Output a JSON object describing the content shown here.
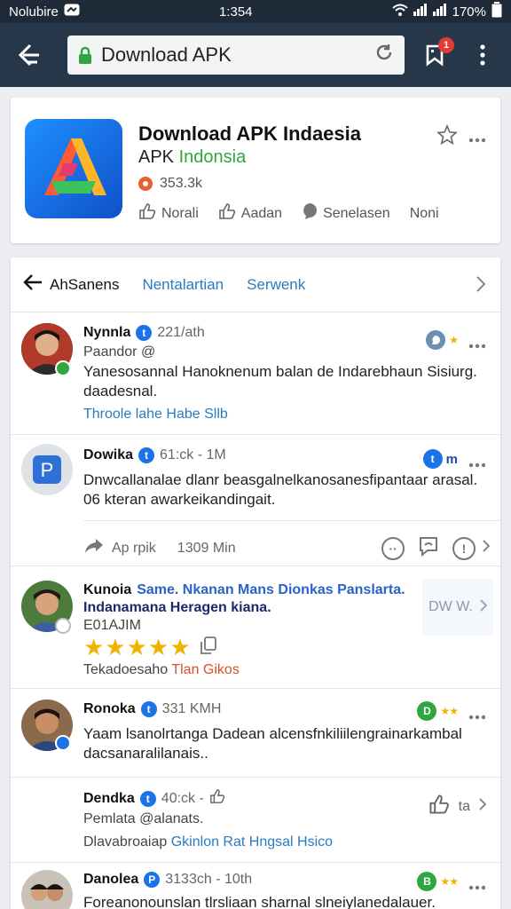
{
  "status_bar": {
    "carrier": "Nolubire",
    "time": "1:354",
    "battery": "170%"
  },
  "browser": {
    "url": "Download APK",
    "notification_count": "1"
  },
  "app": {
    "title": "Download APK Indaesia",
    "subtitle_plain": "APK",
    "subtitle_accent": "Indonsia",
    "rating_count": "353.3k",
    "actions": [
      "Norali",
      "Aadan",
      "Senelasen",
      "Noni"
    ]
  },
  "feed": {
    "tabs": [
      "AhSanens",
      "Nentalartian",
      "Serwenk"
    ],
    "posts": [
      {
        "name": "Nynnla",
        "verified_mark": "t",
        "meta": "221/ath",
        "sub": "Paandor @",
        "body": "Yanesosannal Hanoknenum balan de Indarebhaun Sisiurg. daadesnal.",
        "link": "Throole lahe Habe Sllb"
      },
      {
        "name": "Dowika",
        "verified_mark": "t",
        "meta": "61:ck - 1M",
        "badge_text": "m",
        "body": "Dnwcallanalae dlanr beasgalnelkanosanesfipantaar arasal. 06 kteran awarkeikandingait.",
        "footer_left": "Ap rpik",
        "footer_meta": "1309 Min"
      },
      {
        "name": "Kunoia",
        "highlight": "Same. Nkanan Mans Dionkas Panslarta.",
        "line2": "Indanamana Heragen kiana.",
        "sub": "E01AJIM",
        "rating_stars": "★★★★★",
        "footer_plain": "Tekadoesaho",
        "footer_accent": "Tlan Gikos",
        "side_text": "DW W."
      },
      {
        "name": "Ronoka",
        "verified_mark": "t",
        "meta": "331 KMH",
        "badge_text": "D",
        "body": "Yaam lsanolrtanga Dadean alcensfnkiliilengrainarkambal dacsanaralilanais.."
      },
      {
        "name": "Dendka",
        "verified_mark": "t",
        "meta": "40:ck -",
        "sub": "Pemlata @alanats.",
        "footer_plain": "Dlavabroaiap",
        "footer_link": "Gkinlon Rat Hngsal Hsico",
        "side_text": "ta"
      },
      {
        "name": "Danolea",
        "verified_mark": "P",
        "meta": "3133ch - 10th",
        "badge_text": "B",
        "body": "Foreanonounslan tlrsliaan sharnal slneiylanedalauer."
      }
    ]
  },
  "colors": {
    "topbar": "#27374a",
    "link": "#2a7bc0",
    "green": "#2fa640",
    "verified_blue": "#1a73e8",
    "star_yellow": "#f0b400",
    "notification_red": "#e53935"
  }
}
